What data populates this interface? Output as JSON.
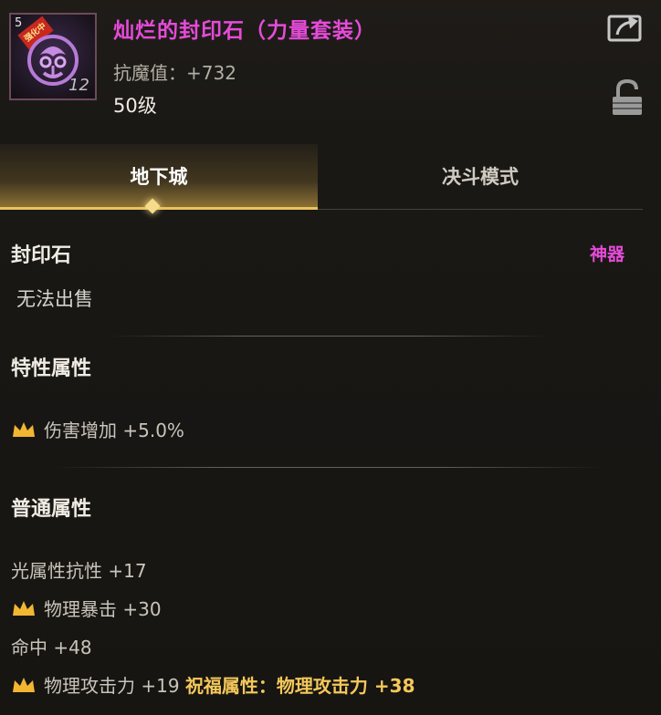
{
  "header": {
    "icon_corner_text": "5",
    "icon_ribbon_text": "强化中",
    "icon_level": "12",
    "item_name": "灿烂的封印石（力量套装）",
    "anti_magic_label": "抗魔值：",
    "anti_magic_value": "+732",
    "level_requirement": "50级"
  },
  "tabs": [
    {
      "label": "地下城",
      "active": true
    },
    {
      "label": "决斗模式",
      "active": false
    }
  ],
  "item_info": {
    "category": "封印石",
    "rarity": "神器",
    "sell_status": "无法出售"
  },
  "special_section": {
    "title": "特性属性",
    "stats": [
      {
        "crown": true,
        "text": "伤害增加 +5.0%"
      }
    ]
  },
  "normal_section": {
    "title": "普通属性",
    "stats": [
      {
        "crown": false,
        "text": "光属性抗性 +17"
      },
      {
        "crown": true,
        "text": "物理暴击 +30"
      },
      {
        "crown": false,
        "text": "命中 +48"
      },
      {
        "crown": true,
        "text": "物理攻击力 +19",
        "blessing": "祝福属性：物理攻击力 +38"
      }
    ]
  },
  "colors": {
    "epic_purple": "#e54bd9",
    "crown_gold": "#f2b632",
    "tab_accent": "#e8c25c"
  },
  "icons": [
    "share-icon",
    "lock-icon",
    "crown-icon",
    "seal-stone-icon"
  ]
}
